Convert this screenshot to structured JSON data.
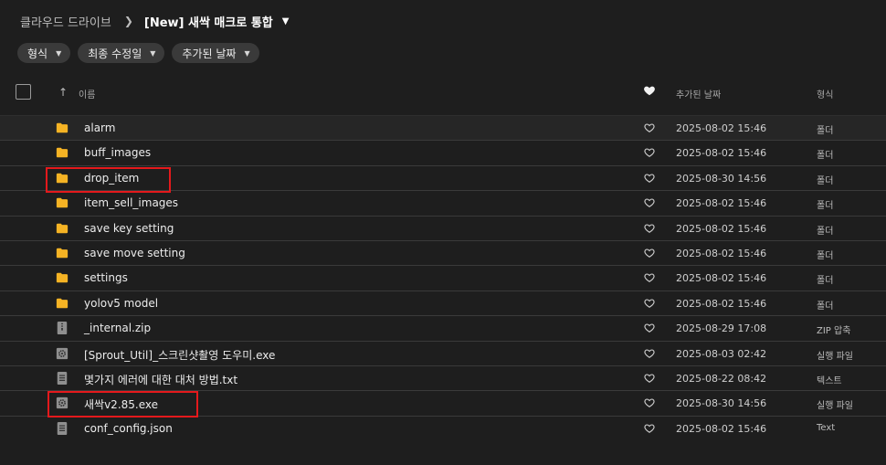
{
  "breadcrumb": {
    "root": "클라우드 드라이브",
    "current": "[New] 새싹 매크로 통합"
  },
  "filters": [
    "형식",
    "최종 수정일",
    "추가된 날짜"
  ],
  "columns": {
    "name": "이름",
    "date": "추가된 날짜",
    "type": "형식"
  },
  "colors": {
    "folder": "#f5b324",
    "file_icon": "#8f8f8f",
    "highlight": "#e4191c"
  },
  "files": [
    {
      "icon": "folder-icon",
      "name": "alarm",
      "date": "2025-08-02 15:46",
      "type": "폴더",
      "highlighted": false
    },
    {
      "icon": "folder-icon",
      "name": "buff_images",
      "date": "2025-08-02 15:46",
      "type": "폴더",
      "highlighted": false
    },
    {
      "icon": "folder-icon",
      "name": "drop_item",
      "date": "2025-08-30 14:56",
      "type": "폴더",
      "highlighted": true
    },
    {
      "icon": "folder-icon",
      "name": "item_sell_images",
      "date": "2025-08-02 15:46",
      "type": "폴더",
      "highlighted": false
    },
    {
      "icon": "folder-icon",
      "name": "save key setting",
      "date": "2025-08-02 15:46",
      "type": "폴더",
      "highlighted": false
    },
    {
      "icon": "folder-icon",
      "name": "save move setting",
      "date": "2025-08-02 15:46",
      "type": "폴더",
      "highlighted": false
    },
    {
      "icon": "folder-icon",
      "name": "settings",
      "date": "2025-08-02 15:46",
      "type": "폴더",
      "highlighted": false
    },
    {
      "icon": "folder-icon",
      "name": "yolov5 model",
      "date": "2025-08-02 15:46",
      "type": "폴더",
      "highlighted": false
    },
    {
      "icon": "zip-icon",
      "name": "_internal.zip",
      "date": "2025-08-29 17:08",
      "type": "ZIP 압축",
      "highlighted": false
    },
    {
      "icon": "exe-icon",
      "name": "[Sprout_Util]_스크린샷촬영 도우미.exe",
      "date": "2025-08-03 02:42",
      "type": "실행 파일",
      "highlighted": false
    },
    {
      "icon": "text-file-icon",
      "name": "몇가지 에러에 대한 대처 방법.txt",
      "date": "2025-08-22 08:42",
      "type": "텍스트",
      "highlighted": false
    },
    {
      "icon": "exe-icon",
      "name": "새싹v2.85.exe",
      "date": "2025-08-30 14:56",
      "type": "실행 파일",
      "highlighted": true
    },
    {
      "icon": "text-file-icon",
      "name": "conf_config.json",
      "date": "2025-08-02 15:46",
      "type": "Text",
      "highlighted": false
    }
  ]
}
